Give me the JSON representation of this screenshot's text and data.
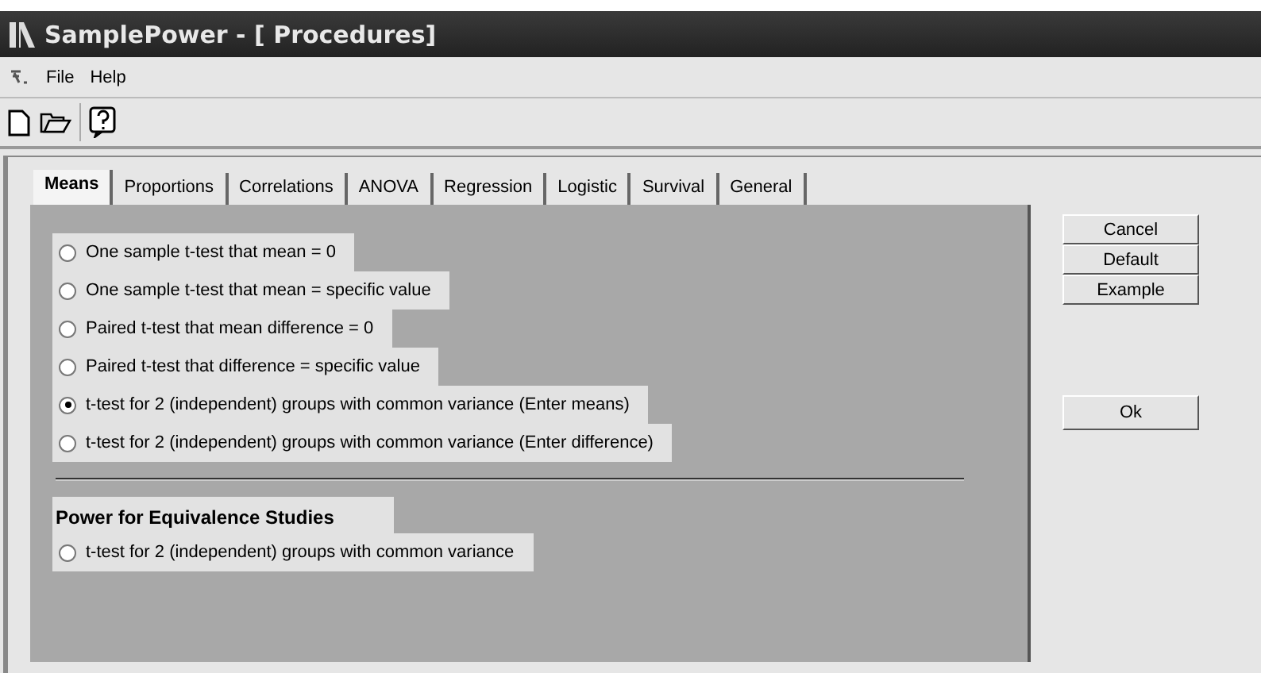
{
  "window": {
    "title": "SamplePower - [ Procedures]"
  },
  "menu": [
    "File",
    "Help"
  ],
  "tabs": [
    {
      "label": "Means",
      "selected": true
    },
    {
      "label": "Proportions",
      "selected": false
    },
    {
      "label": "Correlations",
      "selected": false
    },
    {
      "label": "ANOVA",
      "selected": false
    },
    {
      "label": "Regression",
      "selected": false
    },
    {
      "label": "Logistic",
      "selected": false
    },
    {
      "label": "Survival",
      "selected": false
    },
    {
      "label": "General",
      "selected": false
    }
  ],
  "options": [
    {
      "label": "One sample t-test that mean = 0",
      "selected": false
    },
    {
      "label": "One sample t-test that mean = specific value",
      "selected": false
    },
    {
      "label": "Paired t-test that mean difference = 0",
      "selected": false
    },
    {
      "label": "Paired t-test that difference = specific value",
      "selected": false
    },
    {
      "label": "t-test for 2 (independent) groups with common variance (Enter means)",
      "selected": true
    },
    {
      "label": "t-test for 2 (independent) groups with common variance (Enter difference)",
      "selected": false
    }
  ],
  "equivalence": {
    "heading": "Power for Equivalence Studies",
    "options": [
      {
        "label": "t-test for 2 (independent) groups with common variance",
        "selected": false
      }
    ]
  },
  "buttons": [
    "Cancel",
    "Default",
    "Example"
  ],
  "ok_button": "Ok"
}
